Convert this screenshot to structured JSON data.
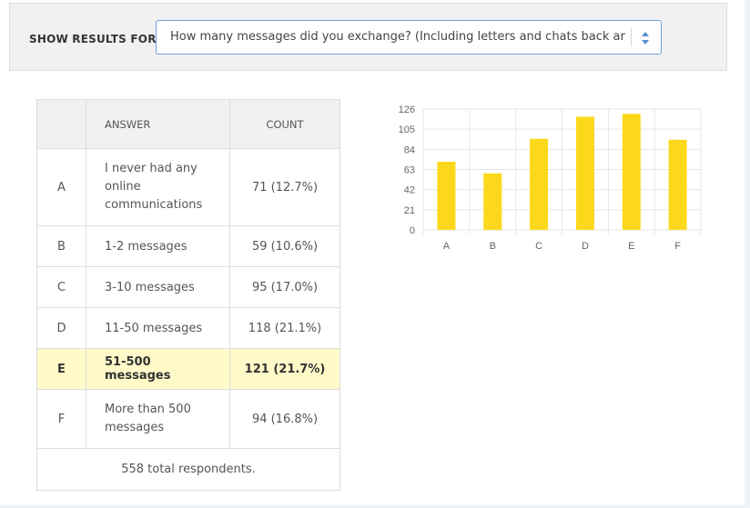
{
  "filter": {
    "label": "SHOW RESULTS FOR:",
    "selected": "How many messages did you exchange? (Including letters and chats back ar"
  },
  "table": {
    "headers": {
      "letter": "",
      "answer": "ANSWER",
      "count": "COUNT"
    },
    "rows": [
      {
        "letter": "A",
        "answer": "I never had any online communications",
        "count": "71 (12.7%)"
      },
      {
        "letter": "B",
        "answer": "1-2 messages",
        "count": "59 (10.6%)"
      },
      {
        "letter": "C",
        "answer": "3-10 messages",
        "count": "95 (17.0%)"
      },
      {
        "letter": "D",
        "answer": "11-50 messages",
        "count": "118 (21.1%)"
      },
      {
        "letter": "E",
        "answer": "51-500 messages",
        "count": "121 (21.7%)"
      },
      {
        "letter": "F",
        "answer": "More than 500 messages",
        "count": "94 (16.8%)"
      }
    ],
    "highlighted_row": "E",
    "total": "558 total respondents."
  },
  "chart_data": {
    "type": "bar",
    "categories": [
      "A",
      "B",
      "C",
      "D",
      "E",
      "F"
    ],
    "values": [
      71,
      59,
      95,
      118,
      121,
      94
    ],
    "yticks": [
      "0",
      "21",
      "42",
      "63",
      "84",
      "105",
      "126"
    ],
    "ylim": [
      0,
      126
    ],
    "grid": true,
    "bar_color": "#fcd81c",
    "grid_color": "#e6e6e6"
  },
  "icons": {
    "select_arrows": "sort-arrows-icon"
  },
  "colors": {
    "select_border": "#6fa0d8",
    "highlight_row": "#fffac8",
    "arrow": "#5b8fd0"
  }
}
